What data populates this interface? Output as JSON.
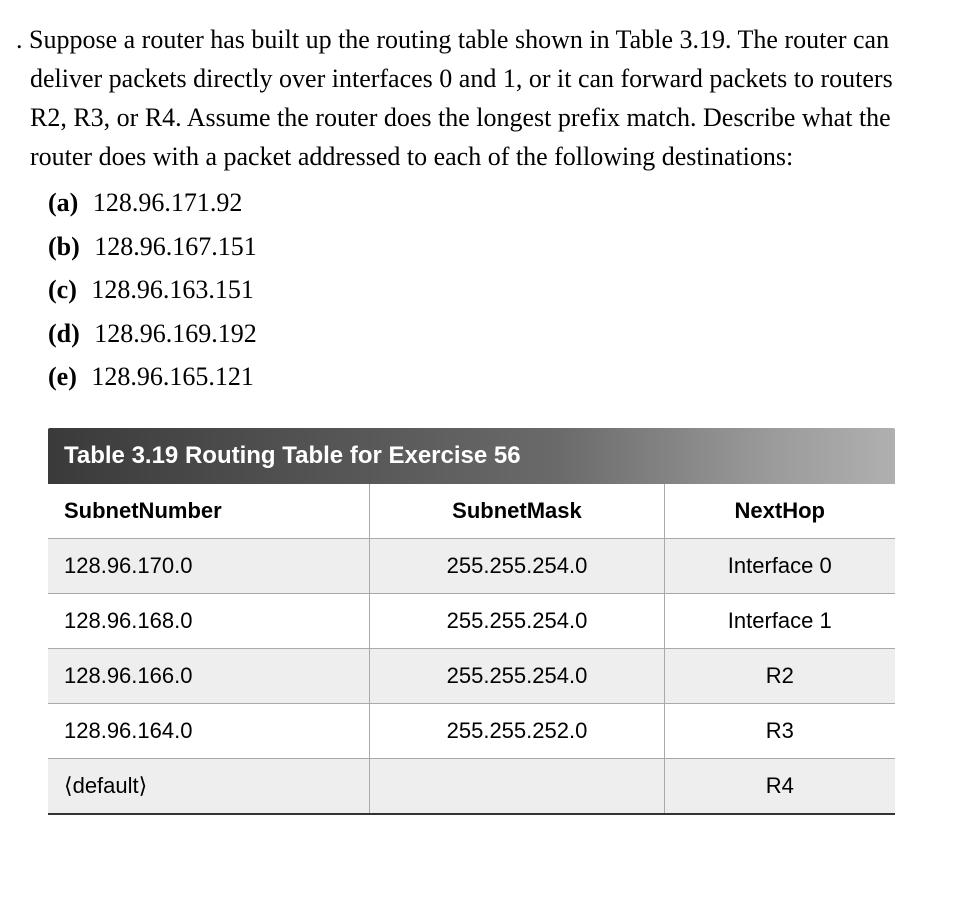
{
  "question": {
    "lead_punct": ".",
    "text": "Suppose a router has built up the routing table shown in Table 3.19. The router can deliver packets directly over interfaces 0 and 1, or it can forward packets to routers R2, R3, or R4. Assume the router does the longest prefix match. Describe what the router does with a packet addressed to each of the following destinations:",
    "items": [
      {
        "label": "(a)",
        "value": "128.96.171.92"
      },
      {
        "label": "(b)",
        "value": "128.96.167.151"
      },
      {
        "label": "(c)",
        "value": "128.96.163.151"
      },
      {
        "label": "(d)",
        "value": "128.96.169.192"
      },
      {
        "label": "(e)",
        "value": "128.96.165.121"
      }
    ]
  },
  "table": {
    "title": "Table 3.19  Routing Table for Exercise 56",
    "headers": {
      "subnet": "SubnetNumber",
      "mask": "SubnetMask",
      "hop": "NextHop"
    },
    "rows": [
      {
        "subnet": "128.96.170.0",
        "mask": "255.255.254.0",
        "hop": "Interface 0"
      },
      {
        "subnet": "128.96.168.0",
        "mask": "255.255.254.0",
        "hop": "Interface 1"
      },
      {
        "subnet": "128.96.166.0",
        "mask": "255.255.254.0",
        "hop": "R2"
      },
      {
        "subnet": "128.96.164.0",
        "mask": "255.255.252.0",
        "hop": "R3"
      },
      {
        "subnet": "⟨default⟩",
        "mask": "",
        "hop": "R4"
      }
    ]
  }
}
